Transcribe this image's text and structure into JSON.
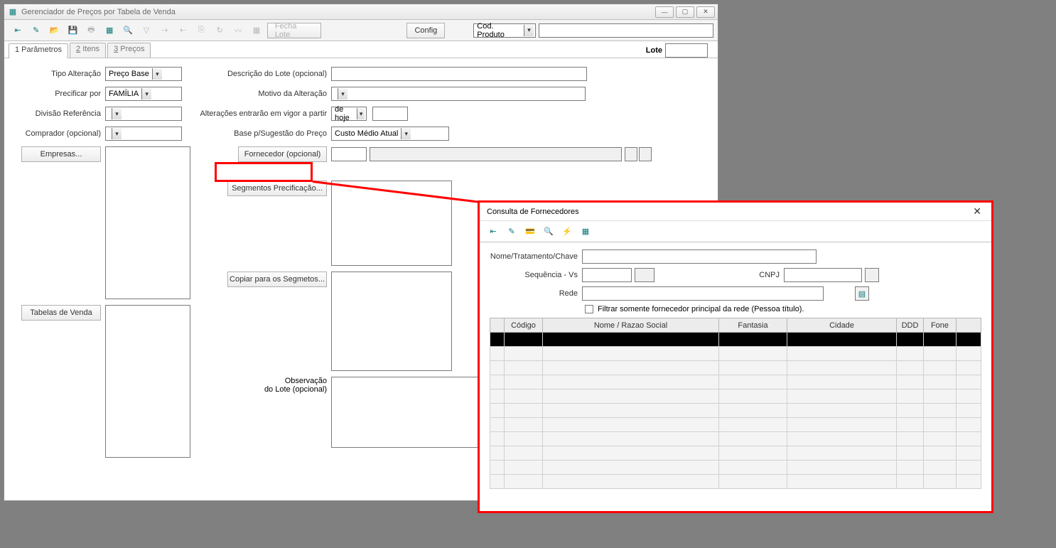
{
  "main": {
    "title": "Gerenciador de Preços por Tabela de Venda",
    "toolbar": {
      "fecha_lote": "Fecha Lote",
      "config": "Config",
      "search_combo": "Cod. Produto"
    },
    "tabs": [
      "1 Parâmetros",
      "2 Itens",
      "3 Preços"
    ],
    "lote_label": "Lote",
    "lote_value": "",
    "labels": {
      "tipo_alteracao": "Tipo Alteração",
      "precificar_por": "Precificar por",
      "divisao_ref": "Divisão Referência",
      "comprador_opt": "Comprador (opcional)",
      "empresas": "Empresas...",
      "tabelas_venda": "Tabelas de Venda",
      "descricao_lote": "Descrição do Lote (opcional)",
      "motivo_alteracao": "Motivo da Alteração",
      "alteracoes_vigor": "Alterações entrarão em vigor a partir",
      "base_sugestao": "Base p/Sugestão do Preço",
      "fornecedor_opt": "Fornecedor (opcional)",
      "segmentos": "Segmentos Precificação...",
      "copiar_segmentos": "Copiar para os Segmetos...",
      "observacao": "Observação",
      "do_lote_opt": "do Lote (opcional)"
    },
    "values": {
      "tipo_alteracao": "Preço Base",
      "precificar_por": "FAMÍLIA",
      "vigor": "de hoje",
      "base_sugestao": "Custo Médio Atual"
    }
  },
  "modal": {
    "title": "Consulta de Fornecedores",
    "labels": {
      "nome": "Nome/Tratamento/Chave",
      "sequencia": "Sequência - Vs",
      "cnpj": "CNPJ",
      "rede": "Rede",
      "filtro": "Filtrar somente fornecedor principal da rede (Pessoa título)."
    },
    "columns": [
      "",
      "Código",
      "Nome / Razao Social",
      "Fantasia",
      "Cidade",
      "DDD",
      "Fone",
      ""
    ]
  }
}
